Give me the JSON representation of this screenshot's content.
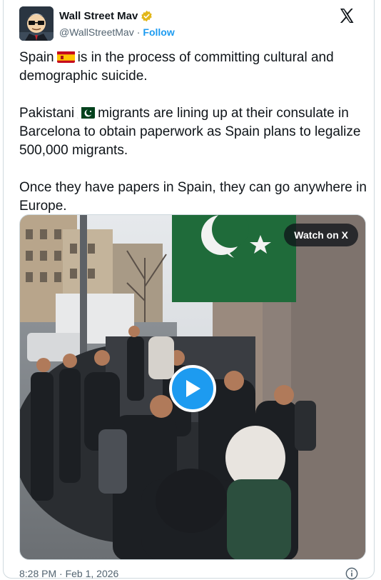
{
  "author": {
    "display_name": "Wall Street Mav",
    "handle": "@WallStreetMav",
    "separator": "·",
    "follow_label": "Follow"
  },
  "tweet": {
    "line1_pre": "Spain",
    "line1_post": "is in the process of committing cultural and demographic suicide.",
    "para2_pre": "Pakistani",
    "para2_post": "migrants are lining up at their consulate in Barcelona to obtain paperwork as Spain plans to legalize 500,000 migrants.",
    "para3": "Once they have papers in Spain, they can go anywhere in Europe."
  },
  "media": {
    "watch_label": "Watch on X"
  },
  "footer": {
    "timestamp": "8:28 PM · Feb 1, 2026"
  },
  "icons": {
    "verified": "verified-badge-icon",
    "logo": "x-logo-icon",
    "play": "play-icon",
    "info": "info-icon"
  },
  "colors": {
    "link": "#1d9bf0",
    "secondary_text": "#536471",
    "verified_gold": "#e2b719",
    "play_button": "#1d9bf0",
    "pakistan_green": "#1f6b3a"
  }
}
